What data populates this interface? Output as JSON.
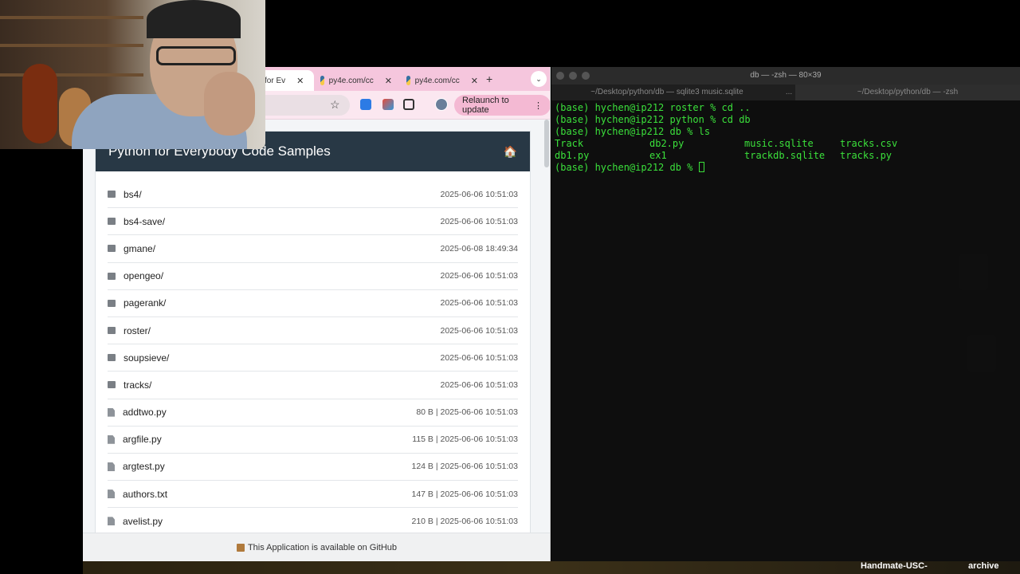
{
  "browser": {
    "tabs": [
      {
        "label": "for Ev",
        "active": true
      },
      {
        "label": "py4e.com/cc"
      },
      {
        "label": "py4e.com/cc"
      }
    ],
    "relaunch_label": "Relaunch to update",
    "page_title": "Python for Everybody Code Samples",
    "entries": [
      {
        "name": "bs4/",
        "type": "folder",
        "meta": "2025-06-06 10:51:03"
      },
      {
        "name": "bs4-save/",
        "type": "folder",
        "meta": "2025-06-06 10:51:03"
      },
      {
        "name": "gmane/",
        "type": "folder",
        "meta": "2025-06-08 18:49:34"
      },
      {
        "name": "opengeo/",
        "type": "folder",
        "meta": "2025-06-06 10:51:03"
      },
      {
        "name": "pagerank/",
        "type": "folder",
        "meta": "2025-06-06 10:51:03"
      },
      {
        "name": "roster/",
        "type": "folder",
        "meta": "2025-06-06 10:51:03"
      },
      {
        "name": "soupsieve/",
        "type": "folder",
        "meta": "2025-06-06 10:51:03"
      },
      {
        "name": "tracks/",
        "type": "folder",
        "meta": "2025-06-06 10:51:03"
      },
      {
        "name": "addtwo.py",
        "type": "file",
        "meta": "80 B | 2025-06-06 10:51:03"
      },
      {
        "name": "argfile.py",
        "type": "file",
        "meta": "115 B | 2025-06-06 10:51:03"
      },
      {
        "name": "argtest.py",
        "type": "file",
        "meta": "124 B | 2025-06-06 10:51:03"
      },
      {
        "name": "authors.txt",
        "type": "file",
        "meta": "147 B | 2025-06-06 10:51:03"
      },
      {
        "name": "avelist.py",
        "type": "file",
        "meta": "210 B | 2025-06-06 10:51:03"
      }
    ],
    "footer_text": "This Application is available on GitHub"
  },
  "terminal": {
    "window_title": "db — -zsh — 80×39",
    "tabs": [
      "~/Desktop/python/db — sqlite3 music.sqlite",
      "...",
      "~/Desktop/python/db — -zsh"
    ],
    "lines": [
      "(base) hychen@ip212 roster % cd ..",
      "(base) hychen@ip212 python % cd db",
      "(base) hychen@ip212 db % ls"
    ],
    "ls_output": [
      [
        "Track",
        "db2.py",
        "music.sqlite",
        "tracks.csv"
      ],
      [
        "db1.py",
        "ex1",
        "trackdb.sqlite",
        "tracks.py"
      ]
    ],
    "prompt": "(base) hychen@ip212 db % "
  },
  "desktop": {
    "labels": [
      "Handmate-USC-",
      "archive"
    ]
  }
}
